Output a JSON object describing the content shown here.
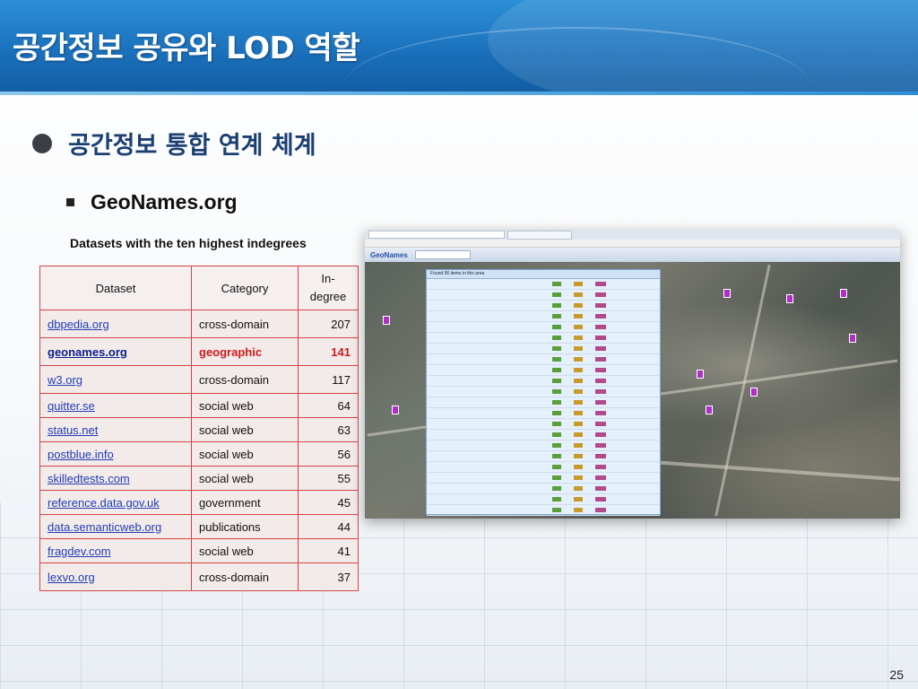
{
  "slide": {
    "title": "공간정보 공유와 LOD 역할",
    "bullet": "공간정보 통합 연계 체계",
    "sub_bullet": "GeoNames.org",
    "caption": "Datasets with the ten highest indegrees",
    "page_number": "25"
  },
  "table": {
    "headers": [
      "Dataset",
      "Category",
      "In-\ndegree"
    ],
    "rows": [
      {
        "dataset": "dbpedia.org",
        "category": "cross-domain",
        "indegree": "207"
      },
      {
        "dataset": "geonames.org",
        "category": "geographic",
        "indegree": "141"
      },
      {
        "dataset": "w3.org",
        "category": "cross-domain",
        "indegree": "117"
      },
      {
        "dataset": "quitter.se",
        "category": "social web",
        "indegree": "64"
      },
      {
        "dataset": "status.net",
        "category": "social web",
        "indegree": "63"
      },
      {
        "dataset": "postblue.info",
        "category": "social web",
        "indegree": "56"
      },
      {
        "dataset": "skilledtests.com",
        "category": "social web",
        "indegree": "55"
      },
      {
        "dataset": "reference.data.gov.uk",
        "category": "government",
        "indegree": "45"
      },
      {
        "dataset": "data.semanticweb.org",
        "category": "publications",
        "indegree": "44"
      },
      {
        "dataset": "fragdev.com",
        "category": "social web",
        "indegree": "41"
      },
      {
        "dataset": "lexvo.org",
        "category": "cross-domain",
        "indegree": "37"
      }
    ],
    "highlight_color": "#d11a1a",
    "border_color": "#d64545"
  },
  "screenshot": {
    "app_name": "GeoNames",
    "results_header": "Found 96 items in this area",
    "results_count": 23
  },
  "colors": {
    "banner": "#1a6fba",
    "bullet_text": "#1b3f72",
    "link": "#1f3fb5"
  }
}
